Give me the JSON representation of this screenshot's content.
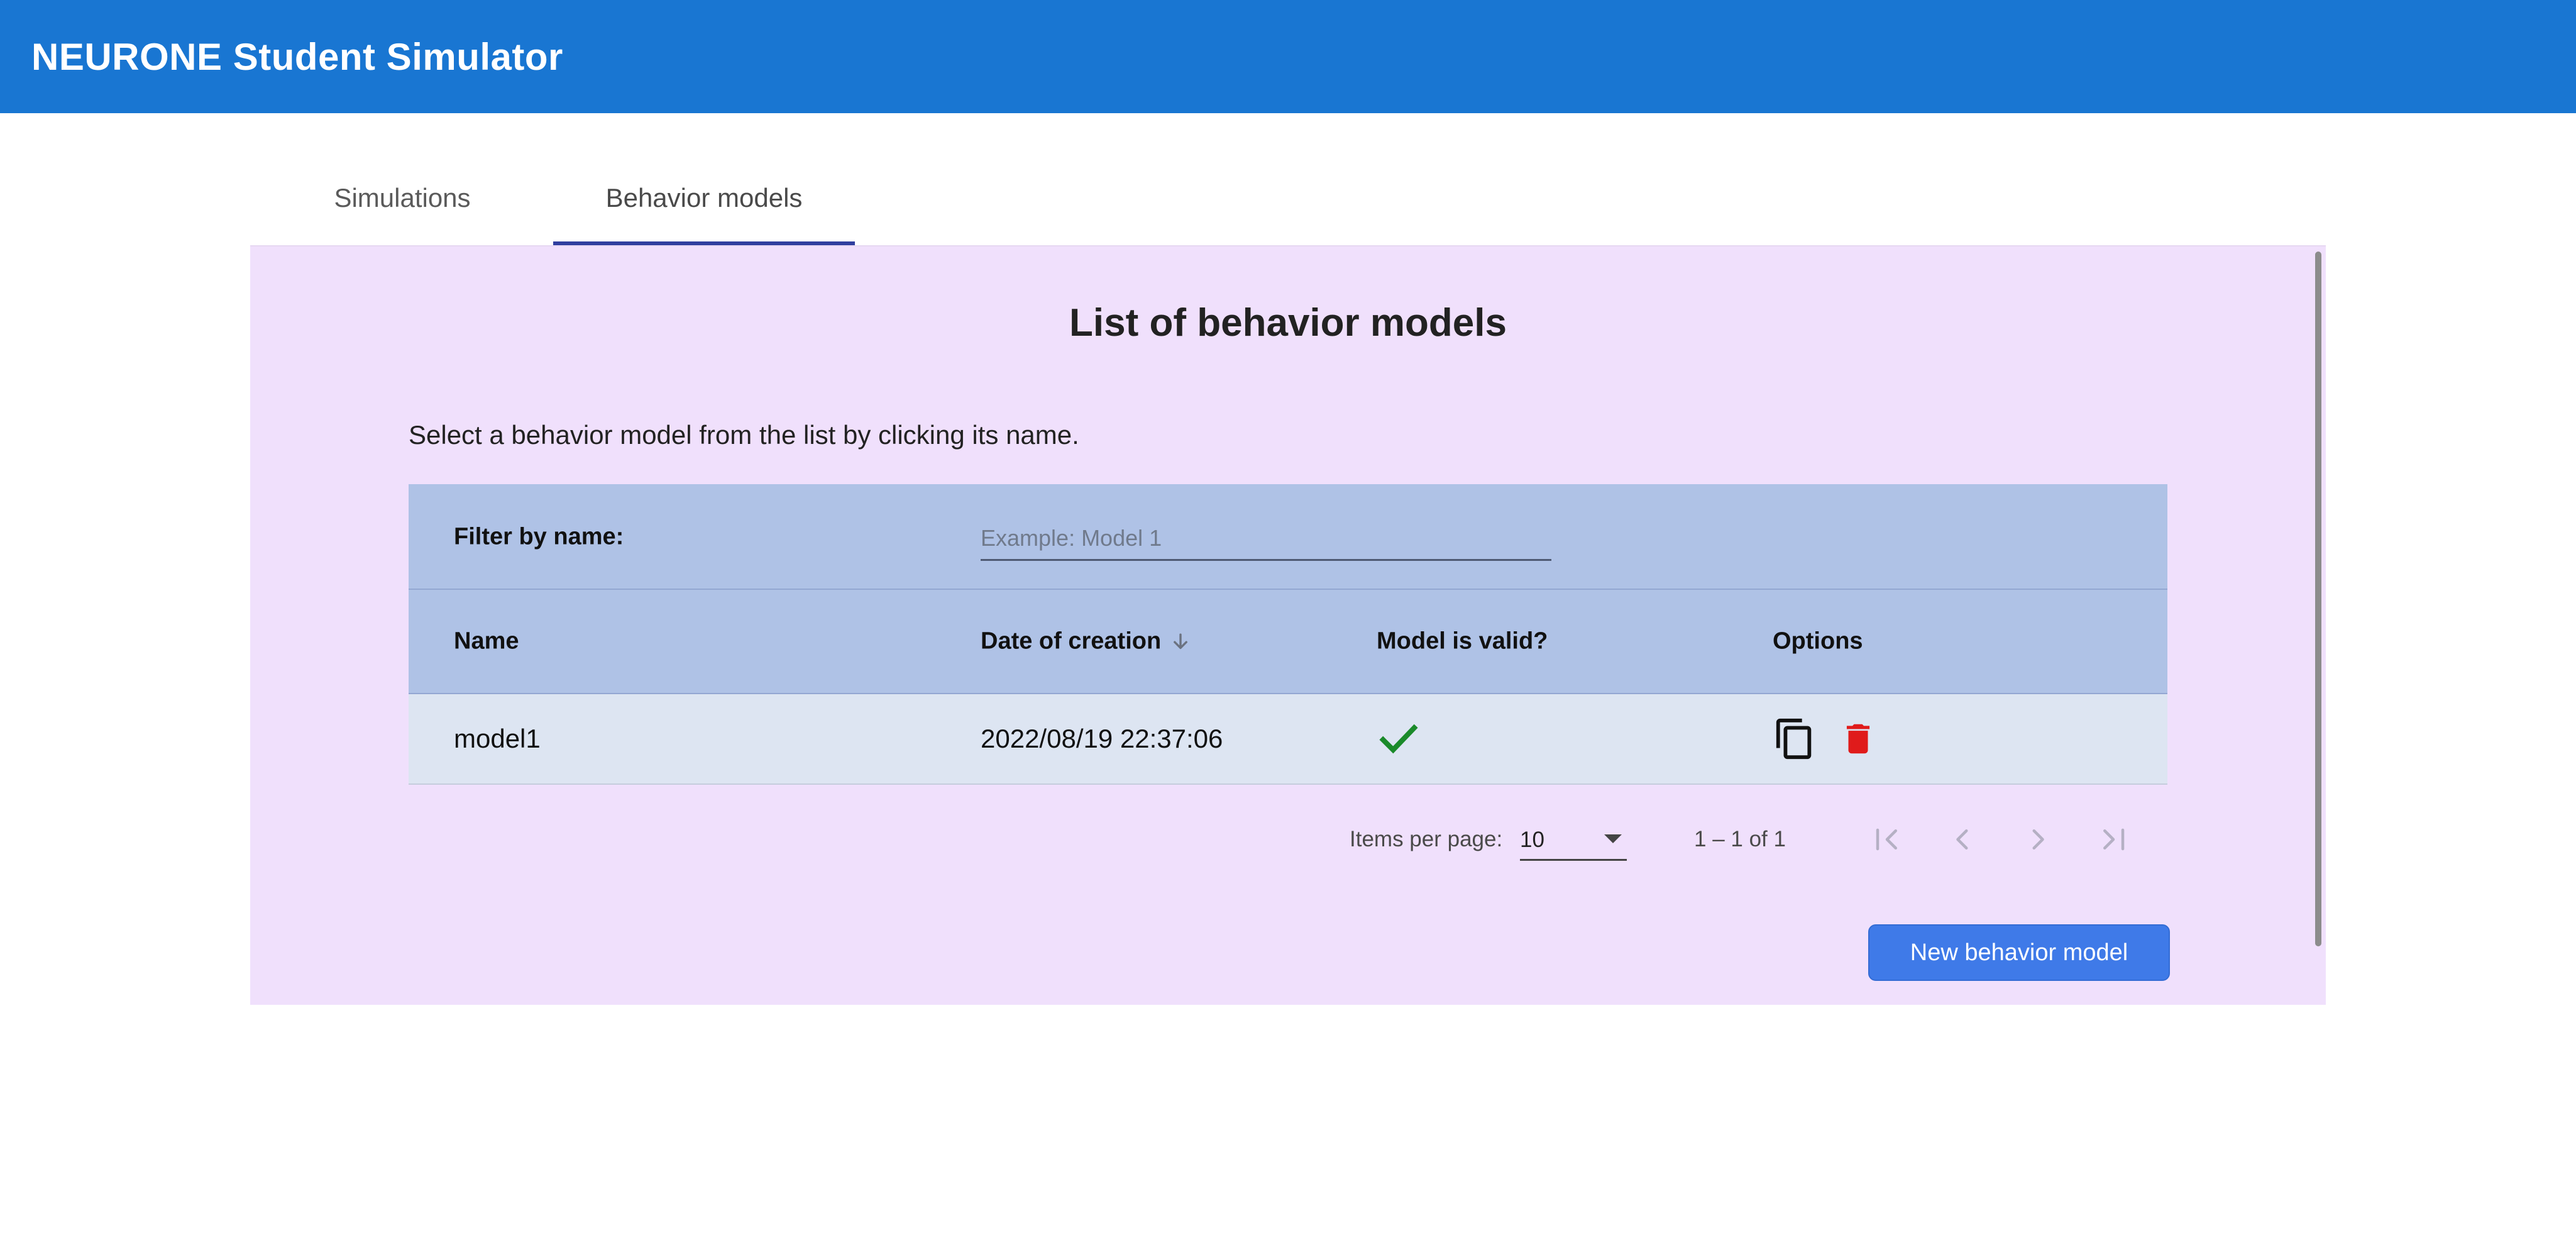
{
  "app": {
    "title": "NEURONE Student Simulator"
  },
  "tabs": [
    {
      "label": "Simulations",
      "active": false
    },
    {
      "label": "Behavior models",
      "active": true
    }
  ],
  "main": {
    "title": "List of behavior models",
    "instructions": "Select a behavior model from the list by clicking its name."
  },
  "filter": {
    "label": "Filter by name:",
    "placeholder": "Example: Model 1",
    "value": ""
  },
  "table": {
    "columns": [
      "Name",
      "Date of creation",
      "Model is valid?",
      "Options"
    ],
    "sort_column": "Date of creation",
    "sort_direction": "descending",
    "rows": [
      {
        "name": "model1",
        "date": "2022/08/19 22:37:06",
        "valid": true
      }
    ]
  },
  "paginator": {
    "items_per_page_label": "Items per page:",
    "items_per_page_value": "10",
    "range_label": "1 – 1 of 1"
  },
  "actions": {
    "new_model_label": "New behavior model"
  },
  "colors": {
    "toolbar": "#1976d2",
    "panel": "#f0e0fc",
    "table_header": "#afc2e6",
    "row": "#dde5f2",
    "valid_check": "#1a8a2a",
    "delete_icon": "#e01b1b",
    "primary_button": "#3f7ae8"
  },
  "icons": {
    "sort": "arrow-down-icon",
    "valid": "check-icon",
    "copy": "copy-icon",
    "delete": "trash-icon",
    "first_page": "first-page-icon",
    "prev_page": "chevron-left-icon",
    "next_page": "chevron-right-icon",
    "last_page": "last-page-icon"
  }
}
